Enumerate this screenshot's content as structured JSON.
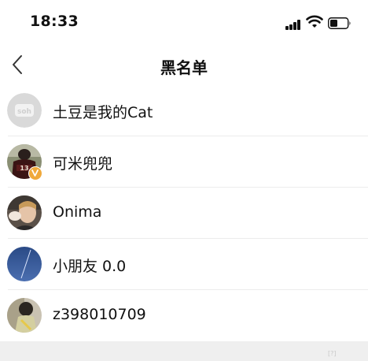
{
  "status_bar": {
    "time": "18:33",
    "icons": [
      "signal-icon",
      "wifi-icon",
      "battery-icon"
    ]
  },
  "nav": {
    "title": "黑名单",
    "back_icon": "chevron-left-icon"
  },
  "blacklist": [
    {
      "name": "土豆是我的Cat",
      "avatar": "placeholder-avatar"
    },
    {
      "name": "可米兜兜",
      "avatar": "football-player-avatar",
      "badge": "v"
    },
    {
      "name": "Onima",
      "avatar": "person-avatar"
    },
    {
      "name": "小朋友 0.0",
      "avatar": "night-sky-avatar"
    },
    {
      "name": "z398010709",
      "avatar": "photo-avatar"
    }
  ],
  "watermark": "[?]"
}
